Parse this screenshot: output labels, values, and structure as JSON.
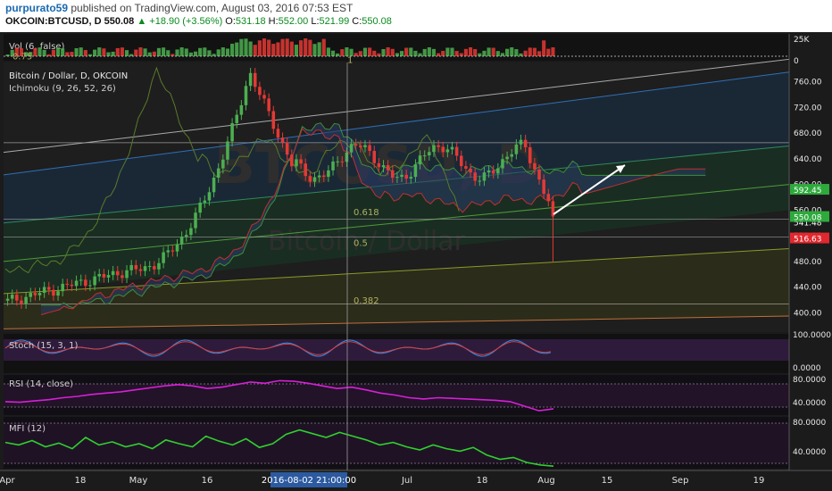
{
  "header": {
    "user": "purpurato59",
    "published": "published on TradingView.com, August 03, 2016 07:53 EST",
    "symbol": "OKCOIN:BTCUSD, D",
    "last": "550.08",
    "change": "▲ +18.90 (+3.56%)",
    "open_label": "O:",
    "open": "531.18",
    "high_label": "H:",
    "high": "552.00",
    "low_label": "L:",
    "low": "521.99",
    "close_label": "C:",
    "close": "550.08"
  },
  "colors": {
    "background": "#1b1b1b",
    "up": "#4caf50",
    "down": "#e53935",
    "price_tag_green": "#2eaa3c",
    "price_tag_red": "#e0282e",
    "stoch_fill": "#3b1f4f",
    "rsi_line": "#d81fd8",
    "mfi_line": "#2fd02f"
  },
  "chart_data": [
    {
      "type": "candlestick",
      "title": "Bitcoin / Dollar, D, OKCOIN",
      "indicator": "Ichimoku (9, 26, 52, 26)",
      "watermark": [
        "BTCUSD, D",
        "Bitcoin / Dollar"
      ],
      "ylim": [
        370,
        790
      ],
      "y_ticks": [
        "760.00",
        "720.00",
        "680.00",
        "640.00",
        "600.00",
        "560.00",
        "520.00",
        "480.00",
        "440.00",
        "400.00"
      ],
      "price_labels": [
        {
          "text": "592.45",
          "value": 592.45,
          "color": "green"
        },
        {
          "text": "541.48",
          "value": 541.48,
          "color": "dark"
        },
        {
          "text": "550.08",
          "value": 550.08,
          "color": "green"
        },
        {
          "text": "516.63",
          "value": 516.63,
          "color": "red"
        }
      ],
      "fib_labels": [
        {
          "text": "1",
          "value": 785
        },
        {
          "text": "0.75",
          "value": 791
        },
        {
          "text": "0.618",
          "value": 548
        },
        {
          "text": "0.5",
          "value": 500
        },
        {
          "text": "0.382",
          "value": 410
        }
      ],
      "horizontal_levels": [
        665,
        546,
        518,
        414
      ],
      "candles_summary": {
        "start_price": 418,
        "peak_price": 775,
        "peak_date": "2016-06-17",
        "last_price": 550.08,
        "last_low": 480
      }
    },
    {
      "type": "bar",
      "title": "Vol (6, false)",
      "ylim": [
        0,
        25000
      ],
      "y_ticks": [
        "25K",
        "0"
      ]
    },
    {
      "type": "line",
      "title": "Stoch (15, 3, 1)",
      "ylim": [
        0,
        100
      ],
      "y_ticks": [
        "100.0000",
        "0.0000"
      ]
    },
    {
      "type": "line",
      "title": "RSI (14, close)",
      "ylim": [
        30,
        90
      ],
      "y_ticks": [
        "80.0000",
        "40.0000"
      ],
      "values": [
        52,
        51,
        53,
        55,
        58,
        60,
        63,
        65,
        67,
        70,
        73,
        76,
        78,
        76,
        72,
        74,
        78,
        82,
        80,
        84,
        83,
        80,
        76,
        72,
        74,
        70,
        65,
        62,
        58,
        56,
        58,
        57,
        56,
        55,
        54,
        52,
        45,
        38,
        41
      ]
    },
    {
      "type": "line",
      "title": "MFI (12)",
      "ylim": [
        20,
        100
      ],
      "y_ticks": [
        "80.0000",
        "40.0000"
      ],
      "values": [
        62,
        58,
        65,
        55,
        61,
        52,
        70,
        58,
        63,
        55,
        60,
        52,
        66,
        60,
        55,
        72,
        64,
        58,
        68,
        54,
        60,
        75,
        82,
        76,
        70,
        78,
        72,
        66,
        58,
        62,
        55,
        50,
        58,
        52,
        48,
        54,
        42,
        35,
        38,
        30,
        26,
        24
      ]
    }
  ],
  "x_axis": {
    "labels": [
      "Apr",
      "18",
      "May",
      "16",
      "Jul",
      "18",
      "Aug",
      "15",
      "Sep",
      "19"
    ],
    "cursor_label": "2016-08-02 21:00:00"
  }
}
